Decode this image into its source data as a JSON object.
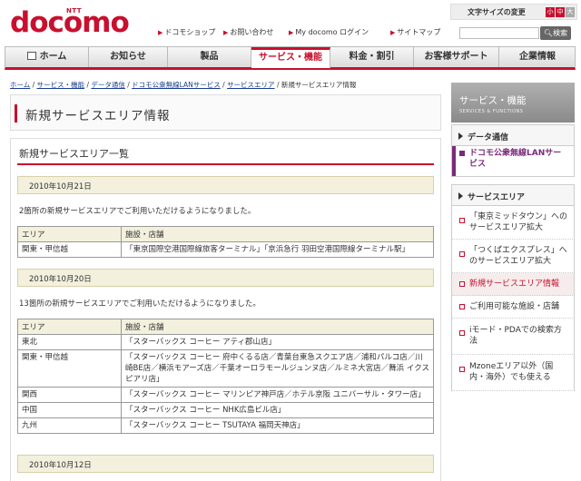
{
  "header": {
    "logo_ntt": "NTT",
    "logo_text": "docomo",
    "font_size_label": "文字サイズの変更",
    "font_sizes": [
      "小",
      "中",
      "大"
    ],
    "links": [
      "ドコモショップ",
      "お問い合わせ",
      "My docomo ログイン",
      "サイトマップ"
    ],
    "search_button": "検索"
  },
  "nav": {
    "items": [
      "ホーム",
      "お知らせ",
      "製品",
      "サービス・機能",
      "料金・割引",
      "お客様サポート",
      "企業情報"
    ],
    "active_index": 3
  },
  "breadcrumb": {
    "items": [
      "ホーム",
      "サービス・機能",
      "データ通信",
      "ドコモ公衆無線LANサービス",
      "サービスエリア"
    ],
    "current": "新規サービスエリア情報"
  },
  "page_title": "新規サービスエリア情報",
  "main": {
    "section_title": "新規サービスエリア一覧",
    "blocks": [
      {
        "date": "2010年10月21日",
        "description": "2箇所の新規サービスエリアでご利用いただけるようになりました。",
        "header": [
          "エリア",
          "施設・店舗"
        ],
        "rows": [
          [
            "関東・甲信越",
            "「東京国際空港国際線旅客ターミナル」「京浜急行 羽田空港国際線ターミナル駅」"
          ]
        ]
      },
      {
        "date": "2010年10月20日",
        "description": "13箇所の新規サービスエリアでご利用いただけるようになりました。",
        "header": [
          "エリア",
          "施設・店舗"
        ],
        "rows": [
          [
            "東北",
            "「スターバックス コーヒー アティ郡山店」"
          ],
          [
            "関東・甲信越",
            "「スターバックス コーヒー 府中くるる店／青葉台東急スクエア店／浦和パルコ店／川崎BE店／横浜モアーズ店／千葉オーロラモールジュンヌ店／ルミネ大宮店／舞浜 イクスピアリ店」"
          ],
          [
            "関西",
            "「スターバックス コーヒー マリンピア神戸店／ホテル京阪 ユニバーサル・タワー店」"
          ],
          [
            "中国",
            "「スターバックス コーヒー NHK広島ビル店」"
          ],
          [
            "九州",
            "「スターバックス コーヒー TSUTAYA 福岡天神店」"
          ]
        ]
      },
      {
        "date": "2010年10月12日"
      }
    ]
  },
  "sidebar": {
    "title": "サービス・機能",
    "subtitle": "SERVICES & FUNCTIONS",
    "cat1": "データ通信",
    "sub1": "ドコモ公衆無線LANサービス",
    "cat2": "サービスエリア",
    "items": [
      "「東京ミッドタウン」へのサービスエリア拡大",
      "「つくばエクスプレス」へのサービスエリア拡大",
      "新規サービスエリア情報",
      "ご利用可能な施設・店舗",
      "iモード・PDAでの検索方法",
      "Mzoneエリア以外（国内・海外）でも使える"
    ],
    "active_item": 2
  },
  "colors": {
    "brand": "#c8102e",
    "accent_purple": "#7a2a7a"
  }
}
